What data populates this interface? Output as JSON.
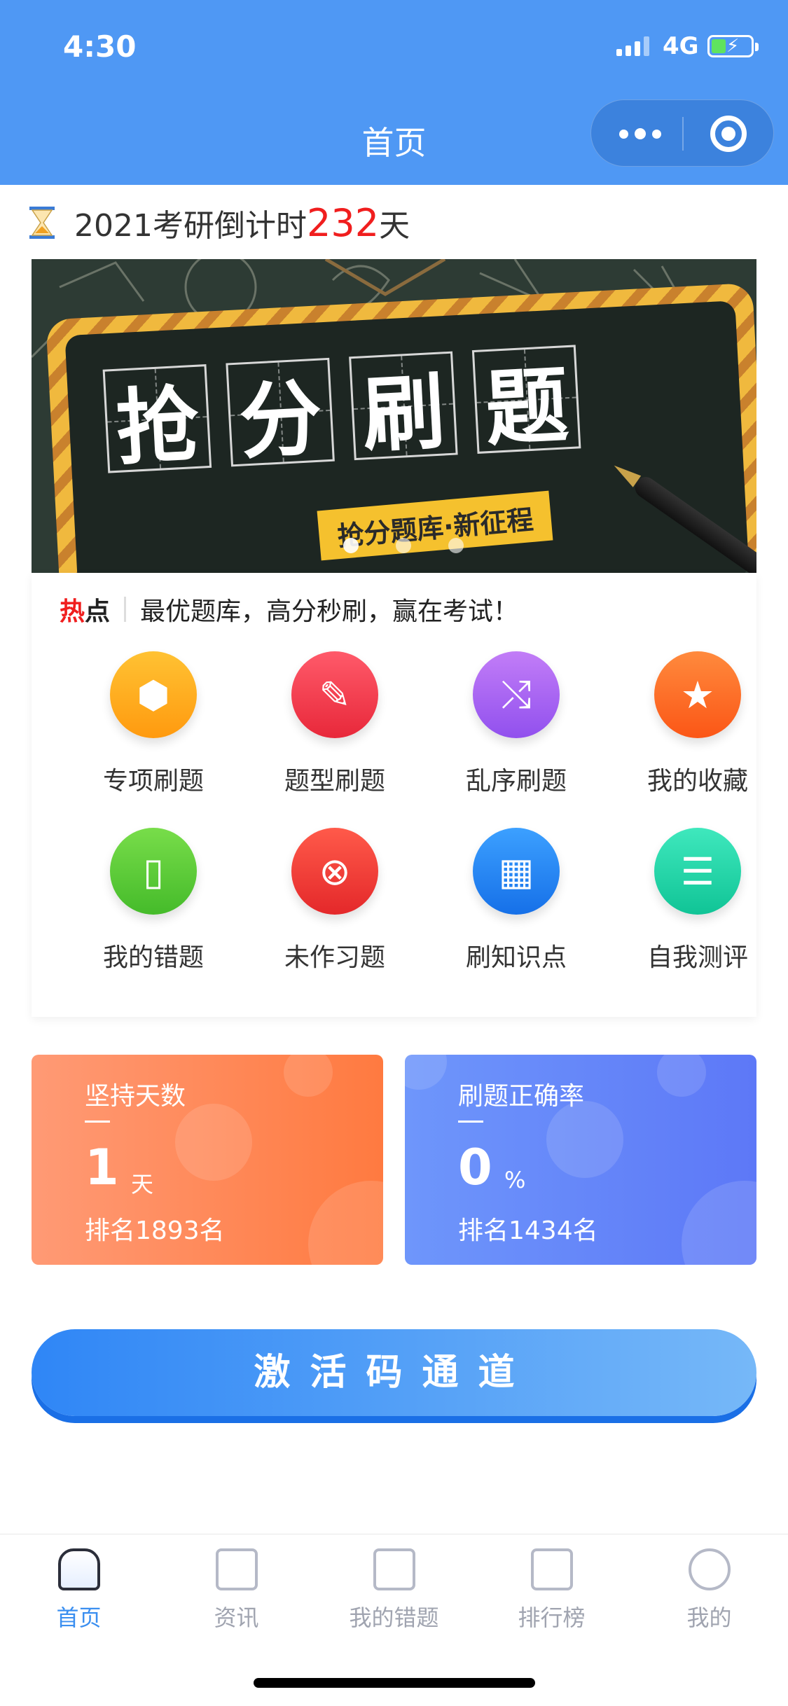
{
  "status_bar": {
    "time": "4:30",
    "network": "4G"
  },
  "nav": {
    "title": "首页"
  },
  "countdown": {
    "prefix": "2021考研倒计时",
    "days": "232",
    "suffix": "天"
  },
  "banner": {
    "chars": [
      "抢",
      "分",
      "刷",
      "题"
    ],
    "tagline": "抢分题库·新征程",
    "slide_count": 3,
    "active_slide": 1
  },
  "hot": {
    "label_red": "热",
    "label_black": "点",
    "text": "最优题库，高分秒刷，赢在考试！"
  },
  "grid": {
    "items": [
      {
        "label": "专项刷题",
        "icon": "cube-icon",
        "color": "#ffad1e"
      },
      {
        "label": "题型刷题",
        "icon": "pencil-icon",
        "color": "#f5404f"
      },
      {
        "label": "乱序刷题",
        "icon": "shuffle-icon",
        "color": "#a45cf0"
      },
      {
        "label": "我的收藏",
        "icon": "star-icon",
        "color": "#ff6a26"
      },
      {
        "label": "我的错题",
        "icon": "wrong-doc-icon",
        "color": "#5ccc3a"
      },
      {
        "label": "未作习题",
        "icon": "clipboard-x-icon",
        "color": "#f23f3a"
      },
      {
        "label": "刷知识点",
        "icon": "grid-apps-icon",
        "color": "#2586f2"
      },
      {
        "label": "自我测评",
        "icon": "clipboard-icon",
        "color": "#1fd3a5"
      }
    ]
  },
  "stats": {
    "persist": {
      "title": "坚持天数",
      "value": "1",
      "unit": "天",
      "rank": "排名1893名"
    },
    "accuracy": {
      "title": "刷题正确率",
      "value": "0",
      "unit": "%",
      "rank": "排名1434名"
    }
  },
  "activate": {
    "label": "激活码通道"
  },
  "tabbar": {
    "items": [
      {
        "label": "首页",
        "icon": "home-icon",
        "active": true
      },
      {
        "label": "资讯",
        "icon": "news-icon",
        "active": false
      },
      {
        "label": "我的错题",
        "icon": "wrong-box-icon",
        "active": false
      },
      {
        "label": "排行榜",
        "icon": "ranking-icon",
        "active": false
      },
      {
        "label": "我的",
        "icon": "profile-icon",
        "active": false
      }
    ]
  },
  "colors": {
    "primary": "#4f98f4",
    "accent_red": "#f01e1e"
  }
}
